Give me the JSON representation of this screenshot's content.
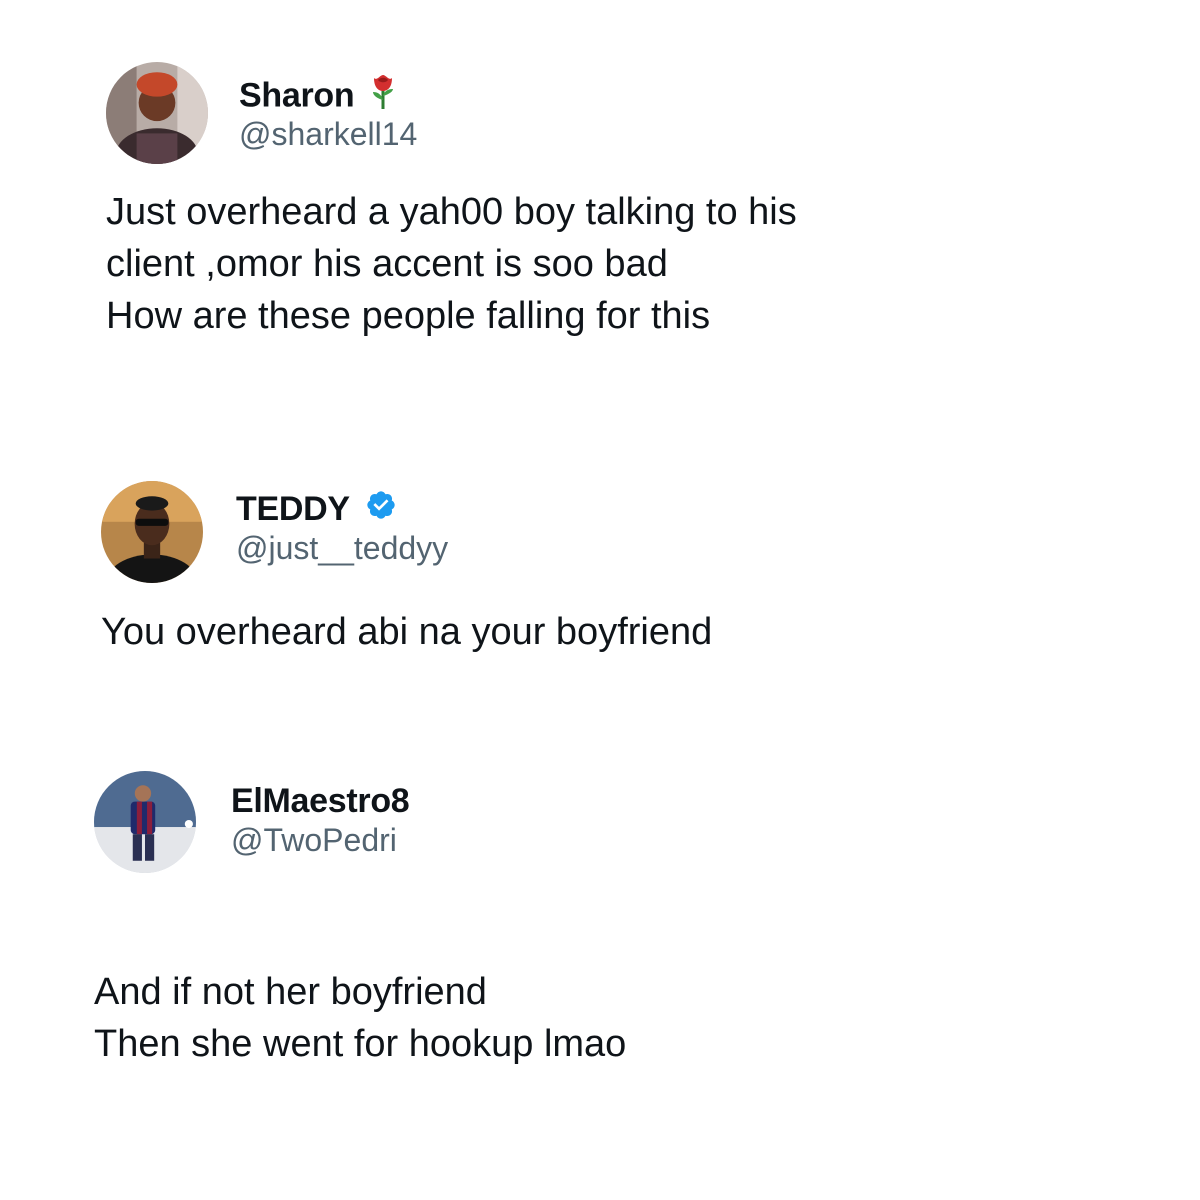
{
  "tweets": [
    {
      "display_name": "Sharon",
      "badge_icon": "rose-emoji-icon",
      "handle": "@sharkell14",
      "lines": [
        "Just overheard a yah00 boy talking to his",
        "client ,omor his accent is soo bad",
        "How are these people falling for this"
      ]
    },
    {
      "display_name": "TEDDY",
      "badge_icon": "verified-badge-icon",
      "badge_color": "#1d9bf0",
      "handle": "@just__teddyy",
      "lines": [
        "You overheard abi na your boyfriend"
      ]
    },
    {
      "display_name": "ElMaestro8",
      "handle": "@TwoPedri",
      "lines": [
        "And if not her boyfriend",
        "Then she went for hookup lmao"
      ]
    }
  ],
  "colors": {
    "text": "#0f1419",
    "secondary": "#536471",
    "verified": "#1d9bf0"
  }
}
